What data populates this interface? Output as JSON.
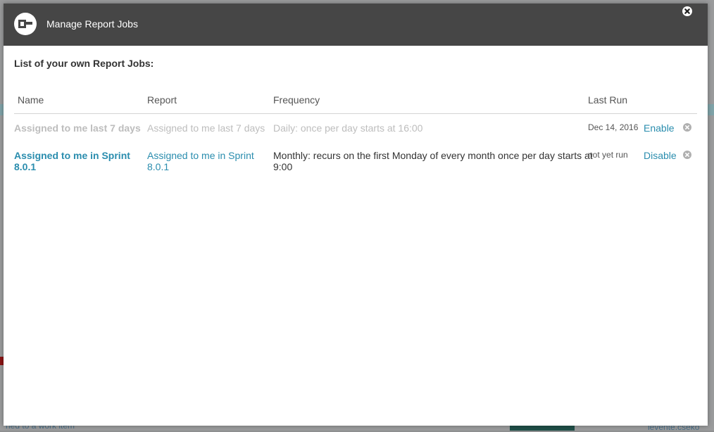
{
  "modal": {
    "title": "Manage Report Jobs",
    "section_title": "List of your own Report Jobs:"
  },
  "table": {
    "headers": {
      "name": "Name",
      "report": "Report",
      "frequency": "Frequency",
      "last_run": "Last Run"
    },
    "rows": [
      {
        "name": "Assigned to me last 7 days",
        "report": "Assigned to me last 7 days",
        "frequency": "Daily: once per day starts at 16:00",
        "last_run": "Dec 14, 2016",
        "action": "Enable",
        "state": "disabled"
      },
      {
        "name_line1": "Assigned to me in Sprint",
        "name_line2": "8.0.1",
        "report_line1": "Assigned to me in Sprint",
        "report_line2": "8.0.1",
        "frequency_line1": "Monthly: recurs on the first Monday of every month once per day starts at",
        "frequency_line2": "9:00",
        "last_run": "not yet run",
        "action": "Disable",
        "state": "enabled"
      }
    ]
  },
  "background": {
    "fragment_1": "ned to a work item",
    "fragment_2": "levente.csekő",
    "button_label": "CLOSED"
  },
  "colors": {
    "header_bg": "#464646",
    "link": "#2a8dae",
    "muted_text": "#bdbdbd"
  },
  "icons": {
    "logo": "app-logo-icon",
    "close": "close-icon",
    "remove": "remove-icon"
  }
}
